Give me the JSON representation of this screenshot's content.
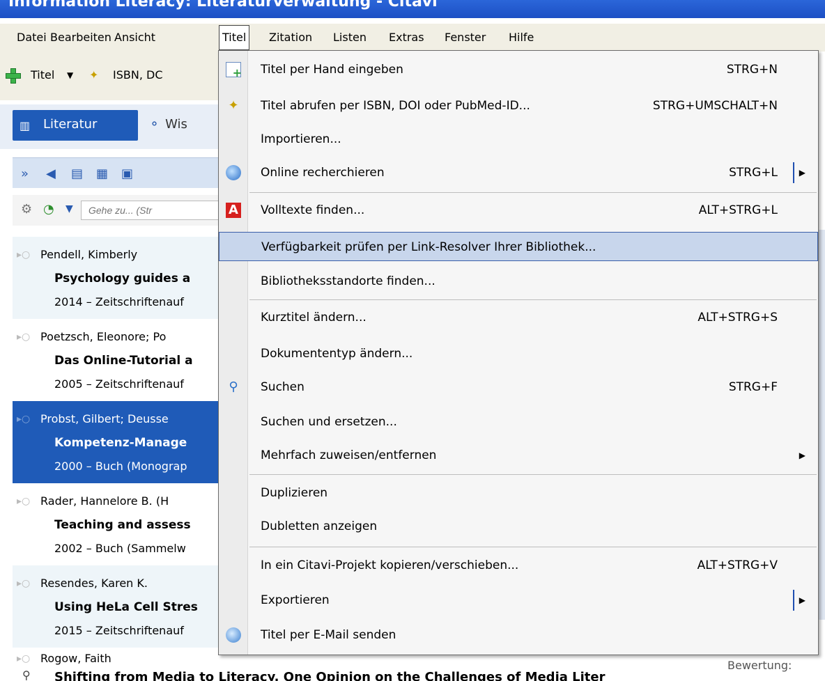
{
  "window": {
    "title": "Information Literacy: Literaturverwaltung - Citavi"
  },
  "menubar": {
    "items": [
      "Datei",
      "Bearbeiten",
      "Ansicht",
      "Titel",
      "Zitation",
      "Listen",
      "Extras",
      "Fenster",
      "Hilfe"
    ],
    "active": "Titel"
  },
  "toolbar": {
    "titel_label": "Titel",
    "isbn_label": "ISBN, DC"
  },
  "tabs": {
    "literatur": "Literatur",
    "wissen": "Wis"
  },
  "search": {
    "placeholder": "Gehe zu... (Str"
  },
  "references": [
    {
      "author": "Pendell, Kimberly",
      "title": "Psychology guides a",
      "meta": "2014 – Zeitschriftenauf"
    },
    {
      "author": "Poetzsch, Eleonore; Po",
      "title": "Das Online-Tutorial a",
      "meta": "2005 – Zeitschriftenauf"
    },
    {
      "author": "Probst, Gilbert; Deusse",
      "title": "Kompetenz-Manage",
      "meta": "2000 – Buch (Monograp"
    },
    {
      "author": "Rader, Hannelore B. (H",
      "title": "Teaching and assess",
      "meta": "2002 – Buch (Sammelw"
    },
    {
      "author": "Resendes, Karen K.",
      "title": "Using HeLa Cell Stres",
      "meta": "2015 – Zeitschriftenauf"
    }
  ],
  "last_reference": {
    "author": "Rogow, Faith",
    "title": "Shifting from Media to Literacy. One Opinion on the Challenges of Media Liter"
  },
  "right_pane": {
    "bewertung": "Bewertung:"
  },
  "titel_menu": {
    "items": [
      {
        "label": "Titel per Hand eingeben",
        "shortcut": "STRG+N"
      },
      {
        "label": "Titel abrufen per ISBN, DOI oder PubMed-ID...",
        "shortcut": "STRG+UMSCHALT+N"
      },
      {
        "label": "Importieren...",
        "shortcut": ""
      },
      {
        "label": "Online recherchieren",
        "shortcut": "STRG+L"
      },
      {
        "label": "Volltexte finden...",
        "shortcut": "ALT+STRG+L"
      },
      {
        "label": "Verfügbarkeit prüfen per Link-Resolver Ihrer Bibliothek...",
        "shortcut": ""
      },
      {
        "label": "Bibliotheksstandorte finden...",
        "shortcut": ""
      },
      {
        "label": "Kurztitel ändern...",
        "shortcut": "ALT+STRG+S"
      },
      {
        "label": "Dokumententyp ändern...",
        "shortcut": ""
      },
      {
        "label": "Suchen",
        "shortcut": "STRG+F"
      },
      {
        "label": "Suchen und ersetzen...",
        "shortcut": ""
      },
      {
        "label": "Mehrfach zuweisen/entfernen",
        "shortcut": ""
      },
      {
        "label": "Duplizieren",
        "shortcut": ""
      },
      {
        "label": "Dubletten anzeigen",
        "shortcut": ""
      },
      {
        "label": "In ein Citavi-Projekt kopieren/verschieben...",
        "shortcut": "ALT+STRG+V"
      },
      {
        "label": "Exportieren",
        "shortcut": ""
      },
      {
        "label": "Titel per E-Mail senden",
        "shortcut": ""
      }
    ]
  }
}
